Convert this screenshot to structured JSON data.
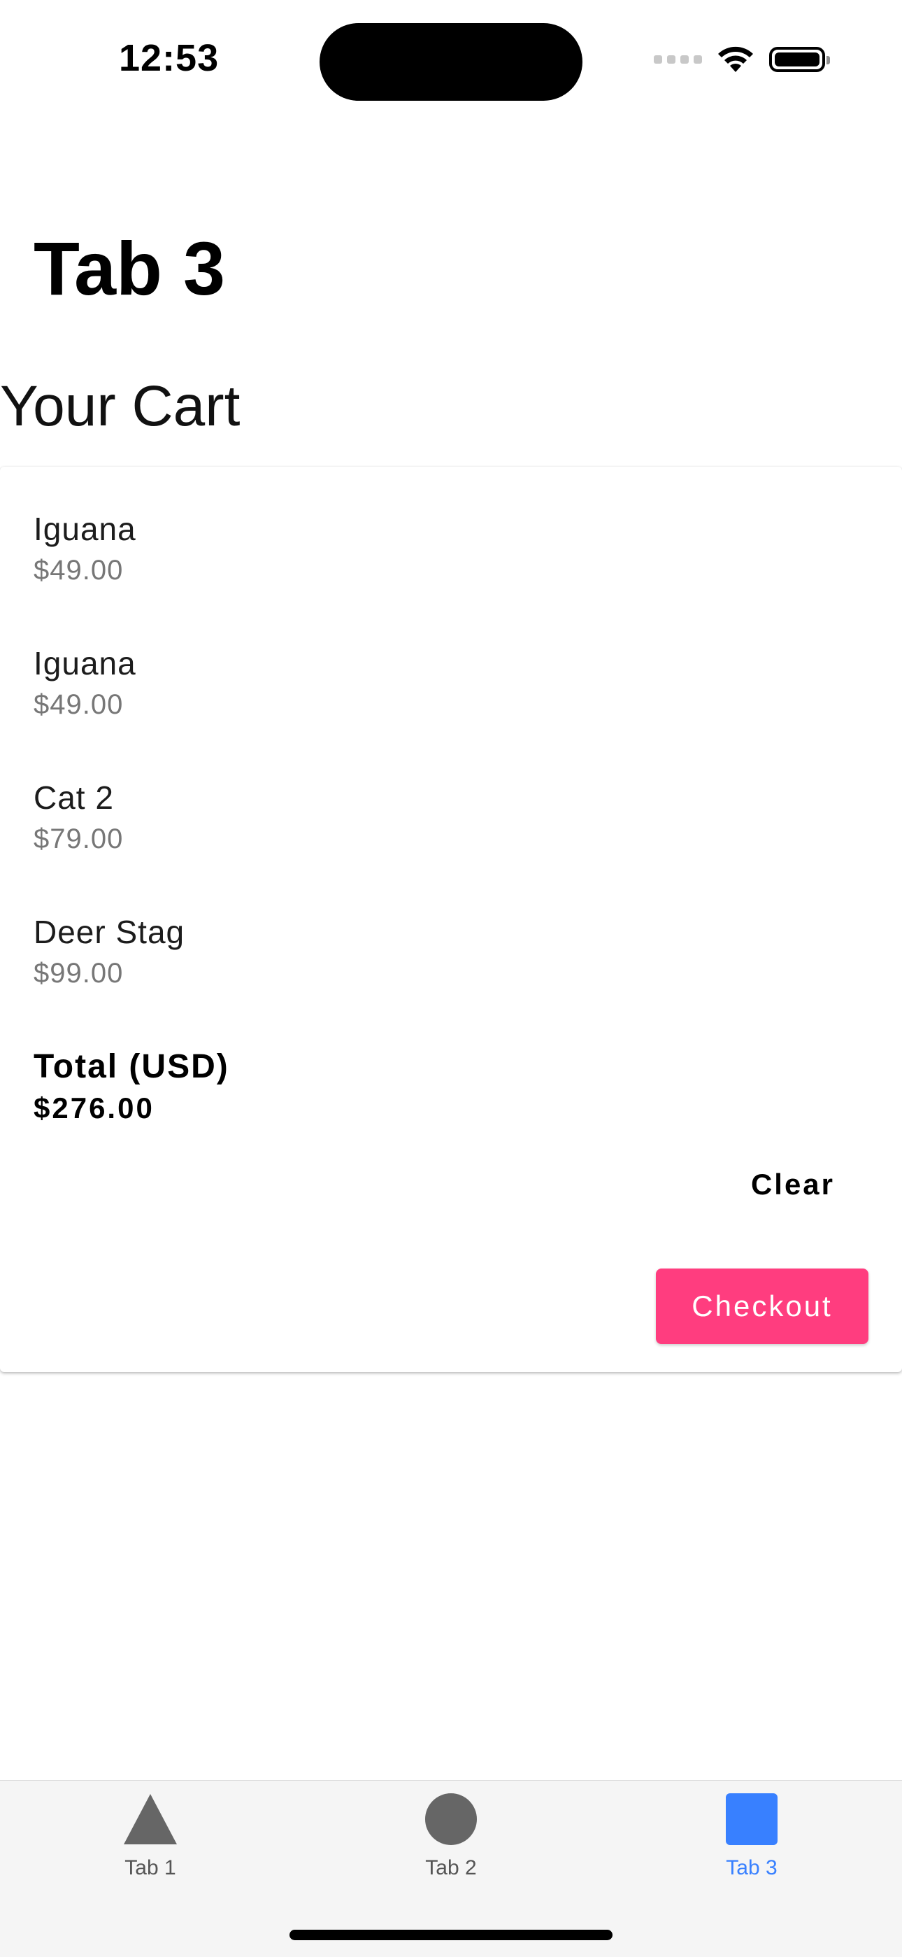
{
  "status_bar": {
    "time": "12:53"
  },
  "header": {
    "title": "Tab 3"
  },
  "cart": {
    "heading": "Your Cart",
    "items": [
      {
        "name": "Iguana",
        "price": "$49.00"
      },
      {
        "name": "Iguana",
        "price": "$49.00"
      },
      {
        "name": "Cat 2",
        "price": "$79.00"
      },
      {
        "name": "Deer Stag",
        "price": "$99.00"
      }
    ],
    "total_label": "Total (USD)",
    "total_value": "$276.00",
    "clear_label": "Clear",
    "checkout_label": "Checkout"
  },
  "tabs": [
    {
      "label": "Tab 1",
      "icon": "triangle-icon",
      "active": false
    },
    {
      "label": "Tab 2",
      "icon": "circle-icon",
      "active": false
    },
    {
      "label": "Tab 3",
      "icon": "square-icon",
      "active": true
    }
  ],
  "colors": {
    "accent": "#3880ff",
    "checkout": "#ff3d7f",
    "inactive_icon": "#666666"
  }
}
